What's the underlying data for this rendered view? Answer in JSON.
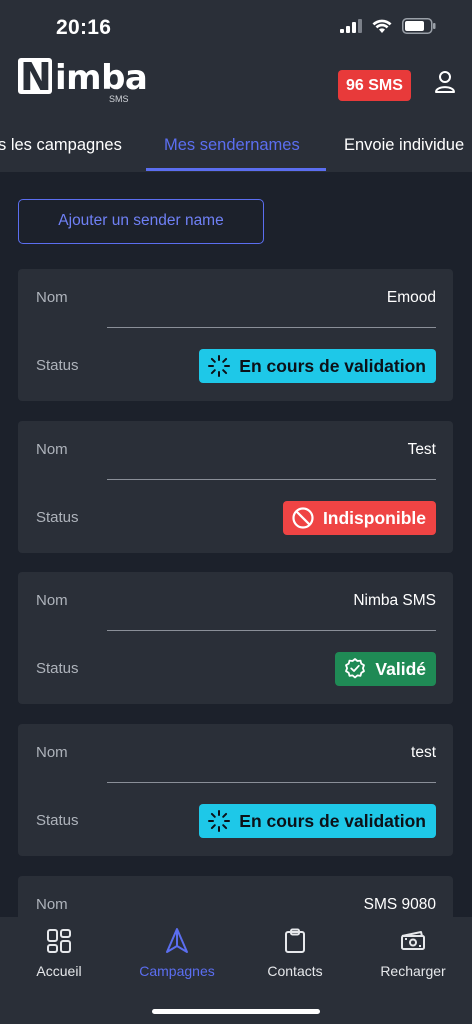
{
  "status_bar": {
    "time": "20:16"
  },
  "header": {
    "logo_main": "Nimba",
    "logo_sub": "SMS",
    "sms_count": "96 SMS"
  },
  "tabs": [
    {
      "label": "s les campagnes"
    },
    {
      "label": "Mes sendernames",
      "active": true
    },
    {
      "label": "Envoie individue"
    }
  ],
  "add_button": {
    "label": "Ajouter un sender name"
  },
  "cards": [
    {
      "name_label": "Nom",
      "name": "Emood",
      "status_label": "Status",
      "status": "En cours de validation",
      "status_kind": "pending"
    },
    {
      "name_label": "Nom",
      "name": "Test",
      "status_label": "Status",
      "status": "Indisponible",
      "status_kind": "unavailable"
    },
    {
      "name_label": "Nom",
      "name": "Nimba SMS",
      "status_label": "Status",
      "status": "Validé",
      "status_kind": "valid"
    },
    {
      "name_label": "Nom",
      "name": "test",
      "status_label": "Status",
      "status": "En cours de validation",
      "status_kind": "pending"
    },
    {
      "name_label": "Nom",
      "name": "SMS 9080"
    }
  ],
  "bottom_nav": [
    {
      "label": "Accueil",
      "icon": "grid-icon"
    },
    {
      "label": "Campagnes",
      "icon": "navigation-arrow-icon",
      "active": true
    },
    {
      "label": "Contacts",
      "icon": "clipboard-icon"
    },
    {
      "label": "Recharger",
      "icon": "money-icon"
    }
  ],
  "colors": {
    "background": "#1c212b",
    "surface": "#2a2f38",
    "accent": "#5b6ef0",
    "pending": "#1ec8e8",
    "unavailable": "#ef4444",
    "valid": "#1f8a55",
    "sms_badge": "#e83a3a"
  }
}
